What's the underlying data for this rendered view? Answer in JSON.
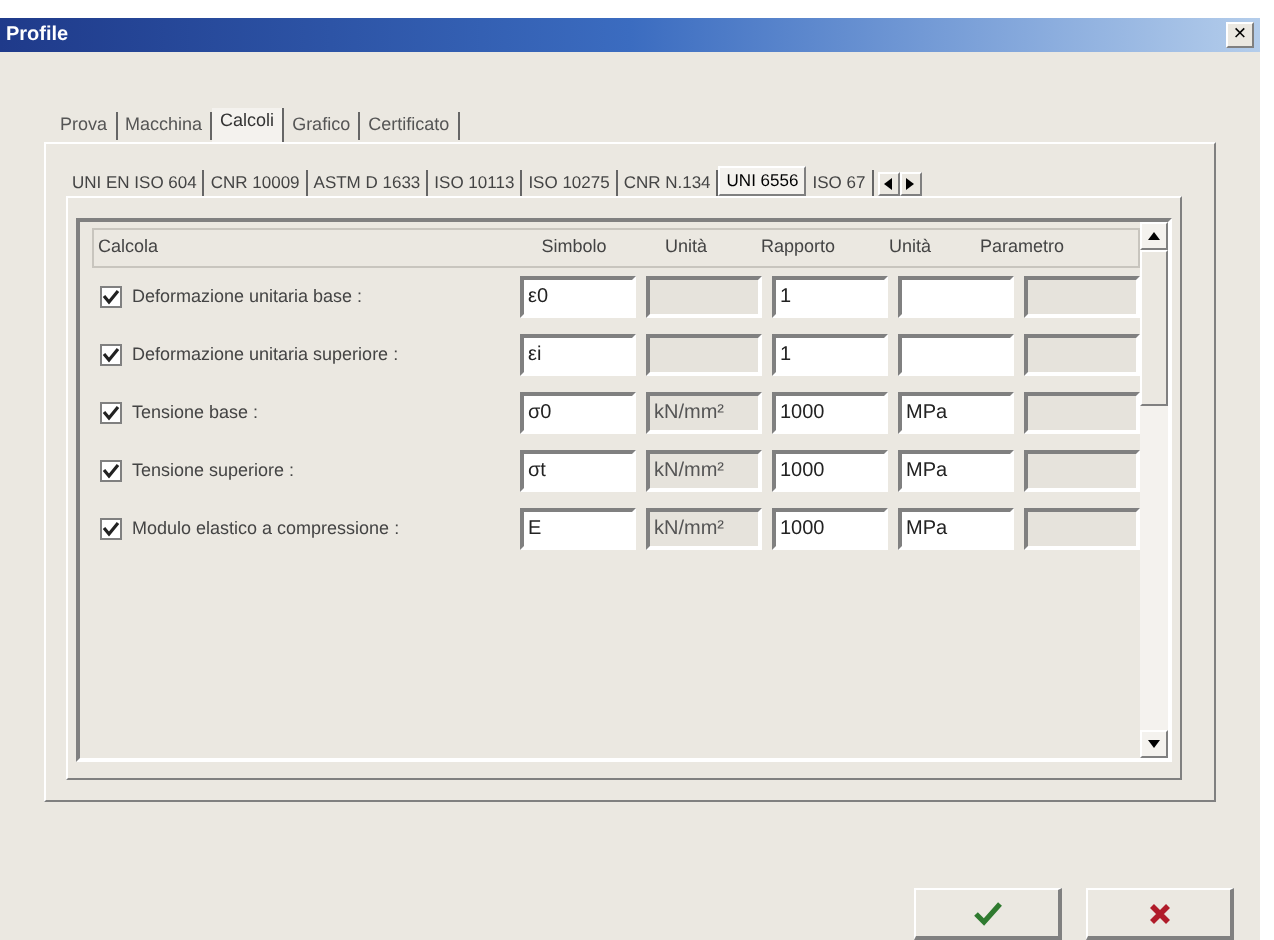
{
  "window": {
    "title": "Profile",
    "close": "×"
  },
  "tabs": [
    {
      "label": "Prova",
      "selected": false
    },
    {
      "label": "Macchina",
      "selected": false
    },
    {
      "label": "Calcoli",
      "selected": true
    },
    {
      "label": "Grafico",
      "selected": false
    },
    {
      "label": "Certificato",
      "selected": false
    }
  ],
  "standard_tabs": [
    {
      "label": "UNI EN ISO 604",
      "selected": false
    },
    {
      "label": "CNR 10009",
      "selected": false
    },
    {
      "label": "ASTM D 1633",
      "selected": false
    },
    {
      "label": "ISO 10113",
      "selected": false
    },
    {
      "label": "ISO 10275",
      "selected": false
    },
    {
      "label": "CNR N.134",
      "selected": false
    },
    {
      "label": "UNI 6556",
      "selected": true
    },
    {
      "label": "ISO 67",
      "selected": false
    }
  ],
  "table": {
    "columns": [
      "Calcola",
      "Simbolo",
      "Unità",
      "Rapporto",
      "Unità",
      "Parametro"
    ],
    "rows": [
      {
        "label": "Deformazione unitaria base :",
        "checked": true,
        "fields": [
          {
            "value": "ε0",
            "disabled": false
          },
          {
            "disabled": true
          },
          {
            "value": "1",
            "disabled": false
          },
          {
            "disabled": false
          },
          {
            "disabled": true
          }
        ]
      },
      {
        "label": "Deformazione unitaria superiore :",
        "checked": true,
        "fields": [
          {
            "value": "εi",
            "disabled": false
          },
          {
            "disabled": true
          },
          {
            "value": "1",
            "disabled": false
          },
          {
            "disabled": false
          },
          {
            "disabled": true
          }
        ]
      },
      {
        "label": "Tensione base :",
        "checked": true,
        "fields": [
          {
            "value": "σ0",
            "disabled": false
          },
          {
            "value": "kN/mm²",
            "disabled": true
          },
          {
            "value": "1000",
            "disabled": false
          },
          {
            "value": "MPa",
            "disabled": false
          },
          {
            "disabled": true
          }
        ]
      },
      {
        "label": "Tensione superiore :",
        "checked": true,
        "fields": [
          {
            "value": "σt",
            "disabled": false
          },
          {
            "value": "kN/mm²",
            "disabled": true
          },
          {
            "value": "1000",
            "disabled": false
          },
          {
            "value": "MPa",
            "disabled": false
          },
          {
            "disabled": true
          }
        ]
      },
      {
        "label": "Modulo elastico a compressione :",
        "checked": true,
        "fields": [
          {
            "value": "E",
            "disabled": false
          },
          {
            "value": "kN/mm²",
            "disabled": true
          },
          {
            "value": "1000",
            "disabled": false
          },
          {
            "value": "MPa",
            "disabled": false
          },
          {
            "disabled": true
          }
        ]
      }
    ]
  },
  "buttons": [
    {
      "kind": "ok"
    },
    {
      "kind": "cancel"
    }
  ]
}
